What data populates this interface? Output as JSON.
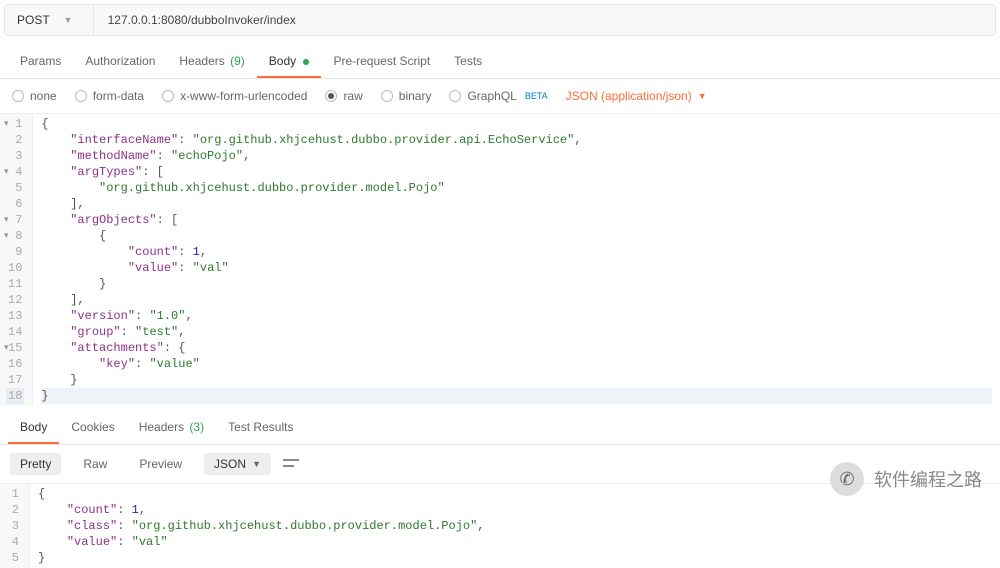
{
  "request": {
    "method": "POST",
    "url": "127.0.0.1:8080/dubboInvoker/index"
  },
  "reqTabs": {
    "params": "Params",
    "authorization": "Authorization",
    "headers": "Headers",
    "headersCount": "(9)",
    "body": "Body",
    "preRequest": "Pre-request Script",
    "tests": "Tests"
  },
  "bodyRadios": {
    "none": "none",
    "formData": "form-data",
    "xwww": "x-www-form-urlencoded",
    "raw": "raw",
    "binary": "binary",
    "graphql": "GraphQL",
    "beta": "BETA",
    "contentType": "JSON (application/json)"
  },
  "reqBody": {
    "lines": [
      "{",
      "    \"interfaceName\": \"org.github.xhjcehust.dubbo.provider.api.EchoService\",",
      "    \"methodName\": \"echoPojo\",",
      "    \"argTypes\": [",
      "        \"org.github.xhjcehust.dubbo.provider.model.Pojo\"",
      "    ],",
      "    \"argObjects\": [",
      "        {",
      "            \"count\": 1,",
      "            \"value\": \"val\"",
      "        }",
      "    ],",
      "    \"version\": \"1.0\",",
      "    \"group\": \"test\",",
      "    \"attachments\": {",
      "        \"key\": \"value\"",
      "    }",
      "}"
    ],
    "foldLines": [
      1,
      4,
      7,
      8,
      15
    ],
    "cursorLine": 18
  },
  "respTabs": {
    "body": "Body",
    "cookies": "Cookies",
    "headers": "Headers",
    "headersCount": "(3)",
    "testResults": "Test Results"
  },
  "respToolbar": {
    "pretty": "Pretty",
    "raw": "Raw",
    "preview": "Preview",
    "lang": "JSON"
  },
  "respBody": {
    "lines": [
      "{",
      "    \"count\": 1,",
      "    \"class\": \"org.github.xhjcehust.dubbo.provider.model.Pojo\",",
      "    \"value\": \"val\"",
      "}"
    ]
  },
  "watermark": {
    "text": "软件编程之路"
  }
}
